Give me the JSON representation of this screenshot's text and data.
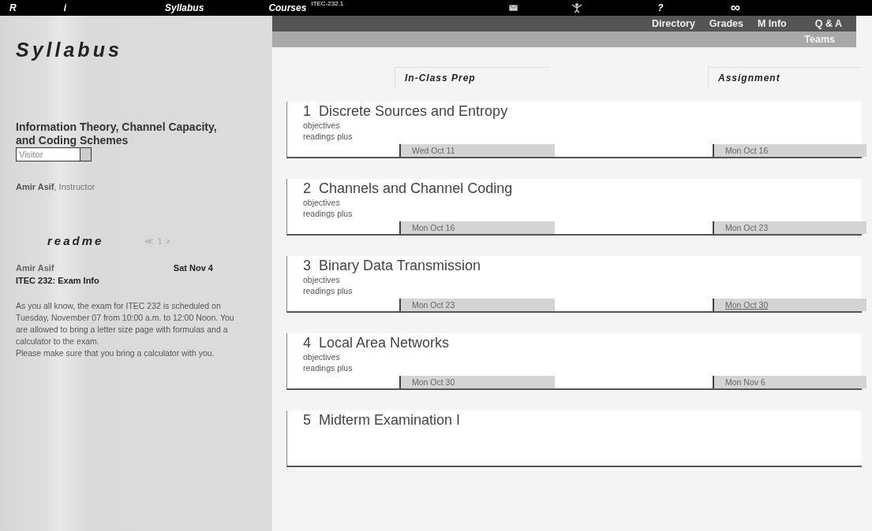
{
  "topbar": {
    "items": [
      {
        "kind": "text",
        "label": "R"
      },
      {
        "kind": "text",
        "label": "i"
      },
      {
        "kind": "text",
        "label": "Syllabus"
      },
      {
        "kind": "text",
        "label": "Courses"
      },
      {
        "kind": "course",
        "label": "ITEC-232.1"
      },
      {
        "kind": "mail"
      },
      {
        "kind": "figure"
      },
      {
        "kind": "text",
        "label": "?"
      },
      {
        "kind": "text",
        "label": "∞"
      }
    ]
  },
  "subnav": {
    "row1": [
      "Directory",
      "Grades",
      "M Info",
      "Q & A"
    ],
    "row2": [
      "Teams"
    ]
  },
  "sidebar": {
    "title": "Syllabus",
    "course_title": "Information Theory, Channel Capacity, and Coding Schemes",
    "role_select": {
      "value": "Visitor"
    },
    "instructor": {
      "name": "Amir Asif",
      "role": ", Instructor"
    },
    "readme": {
      "title": "readme",
      "prev": "≪",
      "page": "1",
      "next": ">",
      "author": "Amir Asif",
      "date": "Sat Nov 4",
      "subject": "ITEC 232: Exam Info",
      "body": [
        "As you all know, the exam for ITEC 232 is scheduled on Tuesday, November 07 from 10:00 a.m. to 12:00 Noon. You are allowed to bring a letter size page with formulas and a calculator to the exam.",
        "Please make sure that you bring a calculator with you."
      ]
    }
  },
  "columns": [
    "In-Class Prep",
    "Assignment"
  ],
  "topics": [
    {
      "number": "1",
      "title": "Discrete Sources and Entropy",
      "links": [
        "objectives",
        "readings plus"
      ],
      "prep": "Wed Oct 11",
      "assignment": "Mon Oct 16",
      "assignment_link": false
    },
    {
      "number": "2",
      "title": "Channels and Channel Coding",
      "links": [
        "objectives",
        "readings plus"
      ],
      "prep": "Mon Oct 16",
      "assignment": "Mon Oct 23",
      "assignment_link": false
    },
    {
      "number": "3",
      "title": "Binary Data Transmission",
      "links": [
        "objectives",
        "readings plus"
      ],
      "prep": "Mon Oct 23",
      "assignment": "Mon Oct 30",
      "assignment_link": true
    },
    {
      "number": "4",
      "title": "Local Area Networks",
      "links": [
        "objectives",
        "readings plus"
      ],
      "prep": "Mon Oct 30",
      "assignment": "Mon Nov 6",
      "assignment_link": false
    },
    {
      "number": "5",
      "title": "Midterm Examination I"
    }
  ]
}
